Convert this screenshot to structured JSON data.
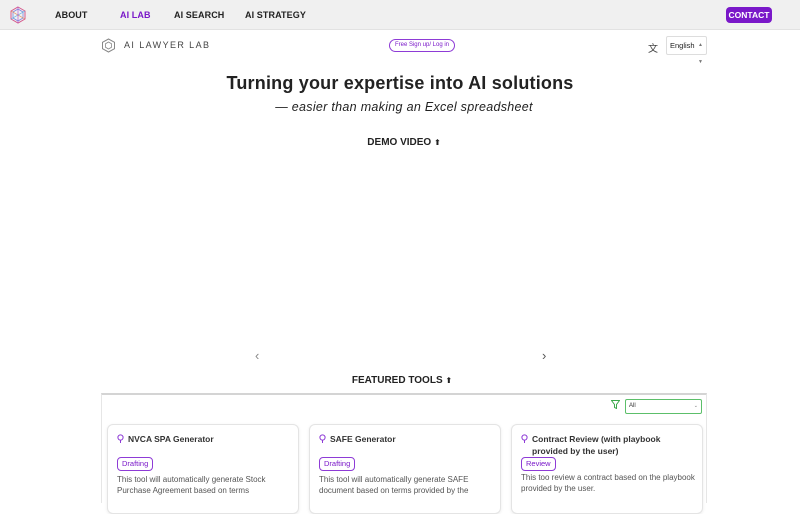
{
  "topnav": {
    "items": [
      {
        "label": "ABOUT",
        "active": false
      },
      {
        "label": "AI LAB",
        "active": true
      },
      {
        "label": "AI SEARCH",
        "active": false
      },
      {
        "label": "AI STRATEGY",
        "active": false
      }
    ],
    "contact_label": "CONTACT",
    "accent_color": "#7a18c9"
  },
  "subheader": {
    "brand": "AI LAWYER LAB",
    "signup_label": "Free Sign up/ Log in",
    "language": "English",
    "translate_icon": "translate-icon"
  },
  "hero": {
    "title": "Turning your expertise into AI solutions",
    "subtitle": "— easier than making an Excel spreadsheet",
    "demo_label": "DEMO VIDEO"
  },
  "carousel": {
    "prev_icon": "chevron-left-icon",
    "next_icon": "chevron-right-icon"
  },
  "featured": {
    "label": "FEATURED TOOLS",
    "filter_value": "All",
    "tools": [
      {
        "title": "NVCA SPA Generator",
        "tag": "Drafting",
        "description": "This tool will automatically generate Stock Purchase Agreement based on terms"
      },
      {
        "title": "SAFE Generator",
        "tag": "Drafting",
        "description": "This tool will automatically generate SAFE document based on terms provided by the"
      },
      {
        "title": "Contract Review (with playbook provided by the user)",
        "tag": "Review",
        "description": "This too review a contract based on the playbook provided by the user."
      }
    ]
  }
}
